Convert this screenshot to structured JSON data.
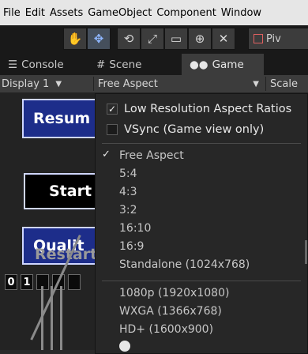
{
  "menubar": [
    "File",
    "Edit",
    "Assets",
    "GameObject",
    "Component",
    "Window"
  ],
  "toolbar": {
    "tools": [
      "hand-icon",
      "move-icon",
      "rotate-icon",
      "scale-icon",
      "rect-icon",
      "transform-icon",
      "custom-tool-icon"
    ],
    "pivot_label": "Piv"
  },
  "tabs": [
    {
      "icon": "list-icon",
      "label": "Console"
    },
    {
      "icon": "hash-icon",
      "label": "Scene"
    },
    {
      "icon": "gamepad-icon",
      "label": "Game"
    }
  ],
  "gamebar": {
    "display": "Display 1",
    "aspect": "Free Aspect",
    "scale": "Scale"
  },
  "game": {
    "btn_resume": "Resum",
    "btn_start": "Start",
    "btn_quality": "Qualit",
    "btn_restart": "Restart",
    "cell_0": "0",
    "cell_1": "1"
  },
  "dropdown": {
    "low_res": "Low Resolution Aspect Ratios",
    "vsync": "VSync (Game view only)",
    "aspects": [
      "Free Aspect",
      "5:4",
      "4:3",
      "3:2",
      "16:10",
      "16:9",
      "Standalone (1024x768)"
    ],
    "resolutions": [
      "1080p (1920x1080)",
      "WXGA (1366x768)",
      "HD+ (1600x900)"
    ]
  }
}
